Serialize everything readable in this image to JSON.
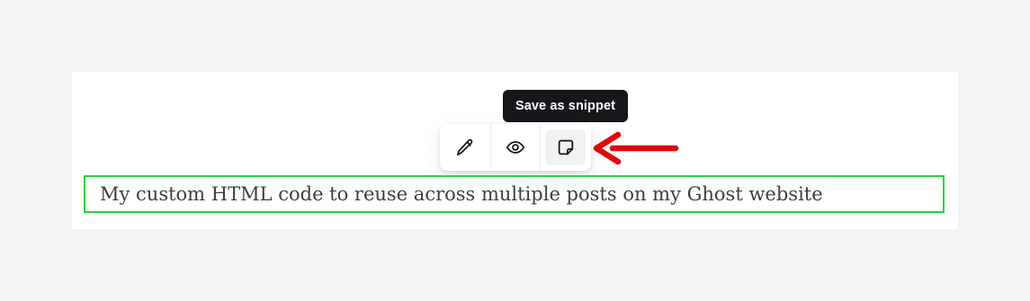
{
  "tooltip": {
    "text": "Save as snippet"
  },
  "toolbar": {
    "items": [
      {
        "name": "edit",
        "icon": "pencil-icon"
      },
      {
        "name": "preview",
        "icon": "eye-icon"
      },
      {
        "name": "save-as-snippet",
        "icon": "snippet-icon"
      }
    ]
  },
  "html_card": {
    "content": "My custom HTML code to reuse across multiple posts on my Ghost website",
    "outline_color": "#30cf43"
  },
  "annotation": {
    "arrow_color": "#e0060b"
  }
}
